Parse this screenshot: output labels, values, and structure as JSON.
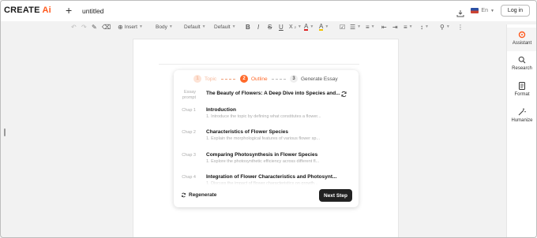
{
  "header": {
    "logo_main": "CREATE",
    "logo_accent": "Ai",
    "new_icon": "plus-icon",
    "doc_title": "untitled",
    "language": "En",
    "login_label": "Log in"
  },
  "toolbar": {
    "insert_label": "Insert",
    "style_label": "Body",
    "font_label": "Default",
    "size_label": "Default"
  },
  "sidebar": {
    "items": [
      {
        "label": "Assistant",
        "icon": "assistant-icon"
      },
      {
        "label": "Research",
        "icon": "search-icon"
      },
      {
        "label": "Format",
        "icon": "document-icon"
      },
      {
        "label": "Humanize",
        "icon": "magic-wand-icon"
      }
    ]
  },
  "wizard": {
    "steps": [
      {
        "num": "1",
        "label": "Topic"
      },
      {
        "num": "2",
        "label": "Outline"
      },
      {
        "num": "3",
        "label": "Generate Essay"
      }
    ],
    "prompt_label": "Essay prompt",
    "prompt_value": "The Beauty of Flowers: A Deep Dive into Species and...",
    "chapters": [
      {
        "label": "Chap 1",
        "title": "Introduction",
        "sub": "1. Introduce the topic by defining what constitutes a flower..."
      },
      {
        "label": "Chap 2",
        "title": "Characteristics of Flower Species",
        "sub": "1. Explain the morphological features of various flower sp..."
      },
      {
        "label": "Chap 3",
        "title": "Comparing Photosynthesis in Flower Species",
        "sub": "1. Explore the photosynthetic efficiency across different fl..."
      },
      {
        "label": "Chap 4",
        "title": "Integration of Flower Characteristics and Photosynt...",
        "sub": "1. Discuss the impact of flower characteristics on growth..."
      }
    ],
    "regenerate_label": "Regenerate",
    "next_label": "Next Step"
  },
  "colors": {
    "accent": "#ff6a2b",
    "accent_light": "#f6b89a",
    "dark_button": "#222222"
  }
}
